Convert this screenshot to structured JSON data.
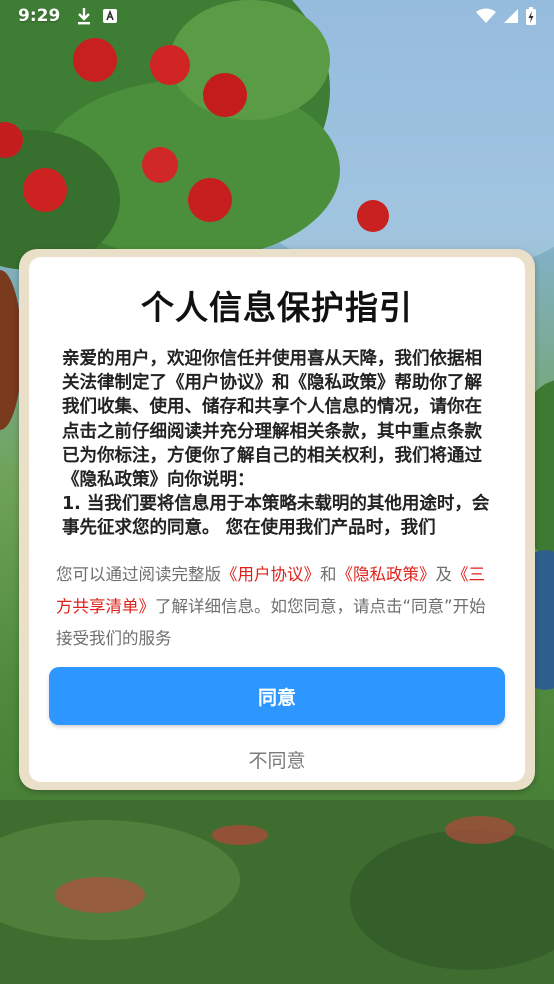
{
  "status_bar": {
    "time": "9:29",
    "icons_left": [
      "download-icon",
      "a-badge-icon"
    ],
    "icons_right": [
      "wifi-icon",
      "cellular-signal-icon",
      "battery-charging-icon"
    ]
  },
  "dialog": {
    "title": "个人信息保护指引",
    "body_paragraphs": [
      "亲爱的用户，欢迎你信任并使用喜从天降，我们依据相关法律制定了《用户协议》和《隐私政策》帮助你了解我们收集、使用、储存和共享个人信息的情况，请你在点击之前仔细阅读并充分理解相关条款，其中重点条款已为你标注，方便你了解自己的相关权利，我们将通过《隐私政策》向你说明：",
      "1. 当我们要将信息用于本策略未载明的其他用途时，会事先征求您的同意。 您在使用我们产品时，我们"
    ],
    "footer": {
      "prefix": "您可以通过阅读完整版",
      "link_user_agreement": "《用户协议》",
      "and": "和",
      "link_privacy_policy": "《隐私政策》",
      "and2": "及",
      "link_third_party": "《三方共享清单》",
      "suffix": "了解详细信息。如您同意，请点击“同意”开始接受我们的服务"
    },
    "agree_label": "同意",
    "disagree_label": "不同意"
  },
  "colors": {
    "primary_button": "#2d97ff",
    "link": "#e0211b",
    "dialog_frame": "#eadfc9"
  }
}
